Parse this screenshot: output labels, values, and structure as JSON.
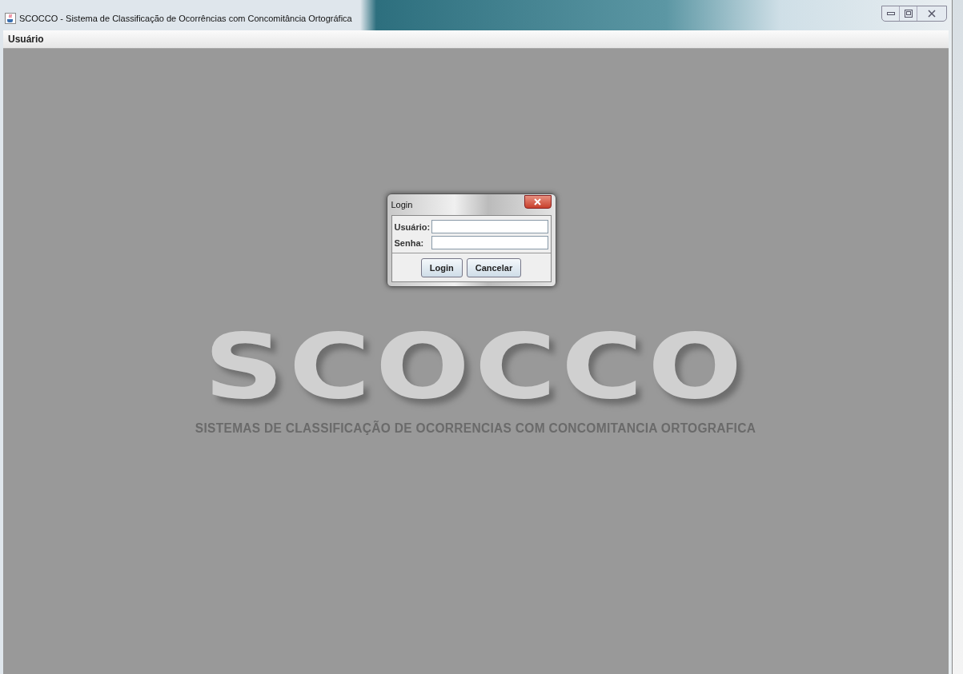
{
  "window": {
    "title": "SCOCCO - Sistema de Classificação de Ocorrências com Concomitância Ortográfica"
  },
  "menu": [
    {
      "label": "Usuário"
    }
  ],
  "login_dialog": {
    "title": "Login",
    "fields": [
      {
        "label": "Usuário:"
      },
      {
        "label": "Senha:"
      }
    ],
    "buttons": [
      "Login",
      "Cancelar"
    ]
  },
  "logo": {
    "wordmark": "SCOCCO",
    "tagline": "SISTEMAS DE CLASSIFICAÇÃO DE OCORRENCIAS COM CONCOMITANCIA ORTOGRAFICA"
  }
}
